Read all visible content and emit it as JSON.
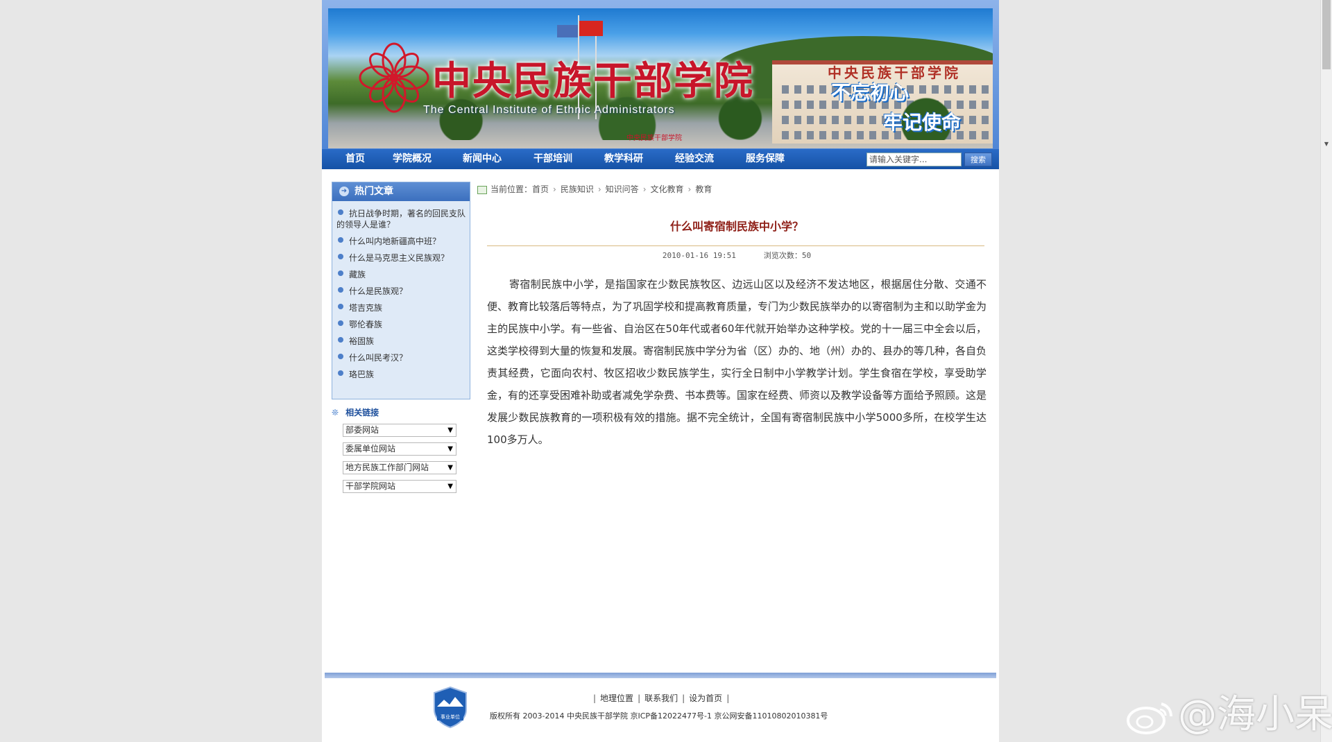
{
  "header": {
    "title_cn": "中央民族干部学院",
    "title_en": "The Central Institute  of Ethnic Administrators",
    "slogan_line1": "不忘初心",
    "slogan_line2": "牢记使命",
    "building_sign": "中央民族干部学院",
    "banner_small_text": "中央民族干部学院"
  },
  "nav": {
    "items": [
      "首页",
      "学院概况",
      "新闻中心",
      "干部培训",
      "教学科研",
      "经验交流",
      "服务保障"
    ],
    "search_placeholder": "请输入关键字...",
    "search_button": "搜索"
  },
  "sidebar": {
    "hot_title": "热门文章",
    "hot_items": [
      "抗日战争时期，著名的回民支队的领导人是谁？",
      "什么叫内地新疆高中班？",
      "什么是马克思主义民族观？",
      "藏族",
      "什么是民族观？",
      "塔吉克族",
      "鄂伦春族",
      "裕固族",
      "什么叫民考汉？",
      "珞巴族"
    ],
    "links_title": "相关链接",
    "link_selects": [
      "部委网站",
      "委属单位网站",
      "地方民族工作部门网站",
      "干部学院网站"
    ]
  },
  "breadcrumb": {
    "prefix": "当前位置：",
    "items": [
      "首页",
      "民族知识",
      "知识问答",
      "文化教育",
      "教育"
    ]
  },
  "article": {
    "title": "什么叫寄宿制民族中小学？",
    "date": "2010-01-16 19:51",
    "views_label": "浏览次数：50",
    "body": "寄宿制民族中小学，是指国家在少数民族牧区、边远山区以及经济不发达地区，根据居住分散、交通不便、教育比较落后等特点，为了巩固学校和提高教育质量，专门为少数民族举办的以寄宿制为主和以助学金为主的民族中小学。有一些省、自治区在50年代或者60年代就开始举办这种学校。党的十一届三中全会以后，这类学校得到大量的恢复和发展。寄宿制民族中学分为省（区）办的、地（州）办的、县办的等几种，各自负责其经费，它面向农村、牧区招收少数民族学生，实行全日制中小学教学计划。学生食宿在学校，享受助学金，有的还享受困难补助或者减免学杂费、书本费等。国家在经费、师资以及教学设备等方面给予照顾。这是发展少数民族教育的一项积极有效的措施。据不完全统计，全国有寄宿制民族中小学5000多所，在校学生达100多万人。"
  },
  "footer": {
    "links": [
      "地理位置",
      "联系我们",
      "设为首页"
    ],
    "copyright": "版权所有 2003-2014 中央民族干部学院 京ICP备12022477号-1 京公网安备11010802010381号",
    "badge_text": "事业单位"
  },
  "watermark": "@海小呆",
  "colors": {
    "nav_blue": "#1552a6",
    "title_red": "#8e1e16",
    "banner_red": "#c8152a"
  }
}
